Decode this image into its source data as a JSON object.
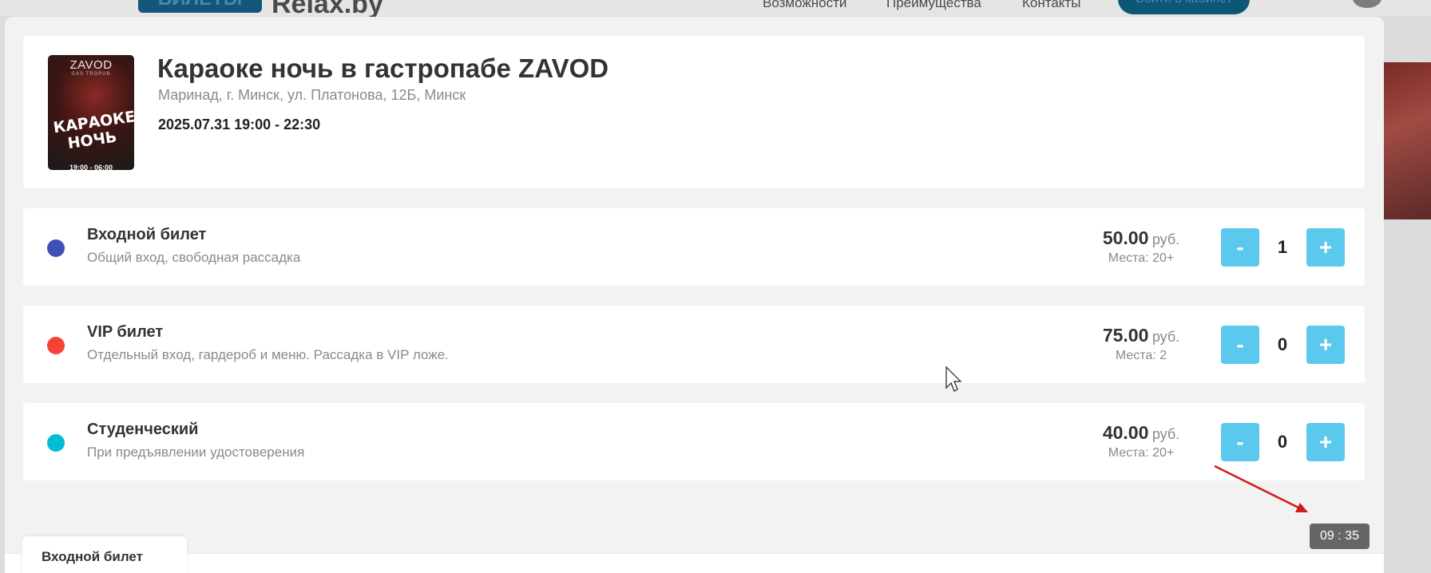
{
  "background": {
    "logo_box": "БИЛЕТЫ",
    "logo_text": "Relax.by",
    "nav": [
      "Возможности",
      "Преимущества",
      "Контакты"
    ],
    "cta": "Войти в кабинет"
  },
  "event": {
    "poster": {
      "brand": "ZAVOD",
      "sub": "GAS TROPUB",
      "main": "КАРАОКЕ НОЧЬ",
      "time": "19:00 - 06:00"
    },
    "title": "Караоке ночь в гастропабе ZAVOD",
    "address": "Маринад, г. Минск, ул. Платонова, 12Б, Минск",
    "datetime": "2025.07.31 19:00 - 22:30"
  },
  "tickets": [
    {
      "name": "Входной билет",
      "description": "Общий вход, свободная рассадка",
      "price": "50.00",
      "currency": "руб.",
      "seats": "Места: 20+",
      "quantity": "1",
      "color": "#3f51b5"
    },
    {
      "name": "VIP билет",
      "description": "Отдельный вход, гардероб и меню. Рассадка в VIP ложе.",
      "price": "75.00",
      "currency": "руб.",
      "seats": "Места: 2",
      "quantity": "0",
      "color": "#f44336"
    },
    {
      "name": "Студенческий",
      "description": "При предъявлении удостоверения",
      "price": "40.00",
      "currency": "руб.",
      "seats": "Места: 20+",
      "quantity": "0",
      "color": "#00bcd4"
    }
  ],
  "controls": {
    "minus_label": "-",
    "plus_label": "+"
  },
  "timer": "09 : 35",
  "bottom_tab": "Входной билет"
}
